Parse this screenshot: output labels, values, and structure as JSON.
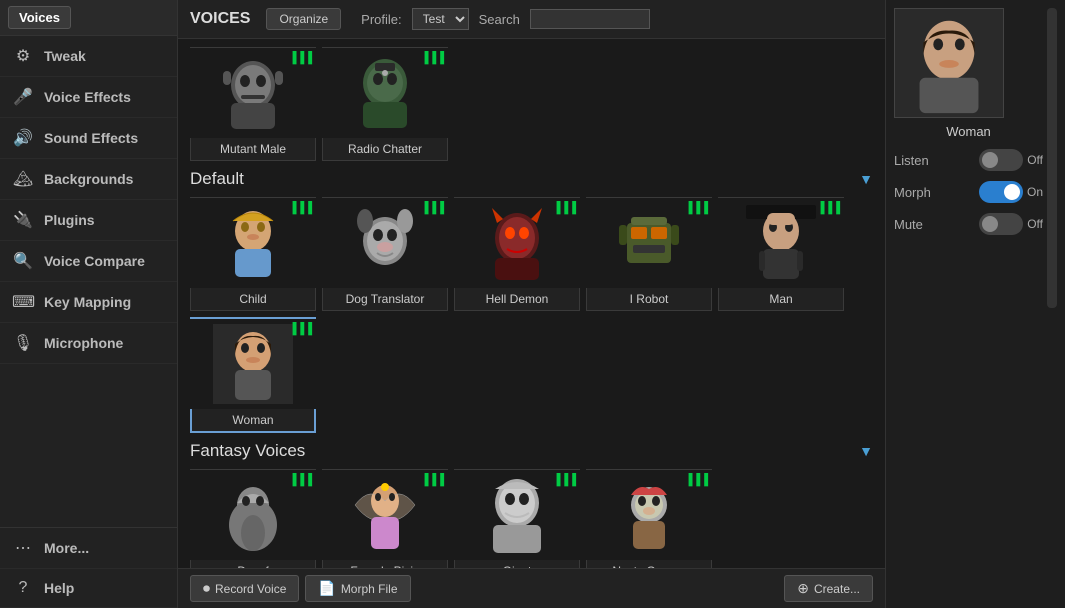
{
  "sidebar": {
    "voices_btn": "Voices",
    "items": [
      {
        "id": "tweak",
        "label": "Tweak",
        "icon": "⚙"
      },
      {
        "id": "voice-effects",
        "label": "Voice Effects",
        "icon": "🎤"
      },
      {
        "id": "sound-effects",
        "label": "Sound Effects",
        "icon": "🔊"
      },
      {
        "id": "backgrounds",
        "label": "Backgrounds",
        "icon": "🏔"
      },
      {
        "id": "plugins",
        "label": "Plugins",
        "icon": "🔌"
      },
      {
        "id": "voice-compare",
        "label": "Voice Compare",
        "icon": "🔍"
      },
      {
        "id": "key-mapping",
        "label": "Key Mapping",
        "icon": "⌨"
      },
      {
        "id": "microphone",
        "label": "Microphone",
        "icon": "🎙"
      }
    ],
    "more": "More...",
    "help": "Help"
  },
  "header": {
    "title": "VOICES",
    "organize_btn": "Organize",
    "profile_label": "Profile:",
    "profile_value": "Test",
    "search_label": "Search"
  },
  "top_voices": [
    {
      "id": "mutant-male",
      "name": "Mutant Male"
    },
    {
      "id": "radio-chatter",
      "name": "Radio Chatter"
    }
  ],
  "sections": [
    {
      "id": "default",
      "title": "Default",
      "voices": [
        {
          "id": "child",
          "name": "Child"
        },
        {
          "id": "dog-translator",
          "name": "Dog Translator"
        },
        {
          "id": "hell-demon",
          "name": "Hell Demon"
        },
        {
          "id": "i-robot",
          "name": "I Robot"
        },
        {
          "id": "man",
          "name": "Man"
        },
        {
          "id": "woman",
          "name": "Woman",
          "selected": true
        }
      ]
    },
    {
      "id": "fantasy-voices",
      "title": "Fantasy Voices",
      "voices": [
        {
          "id": "dwarf",
          "name": "Dwarf"
        },
        {
          "id": "female-pixie",
          "name": "Female Pixie"
        },
        {
          "id": "giant",
          "name": "Giant"
        },
        {
          "id": "nasty-gnome",
          "name": "Nasty Gnome"
        }
      ]
    }
  ],
  "bottom_bar": {
    "record_btn": "Record Voice",
    "morph_btn": "Morph File",
    "create_btn": "Create..."
  },
  "right_panel": {
    "preview_name": "Woman",
    "listen_label": "Listen",
    "listen_state": "Off",
    "morph_label": "Morph",
    "morph_state": "On",
    "mute_label": "Mute",
    "mute_state": "Off"
  }
}
